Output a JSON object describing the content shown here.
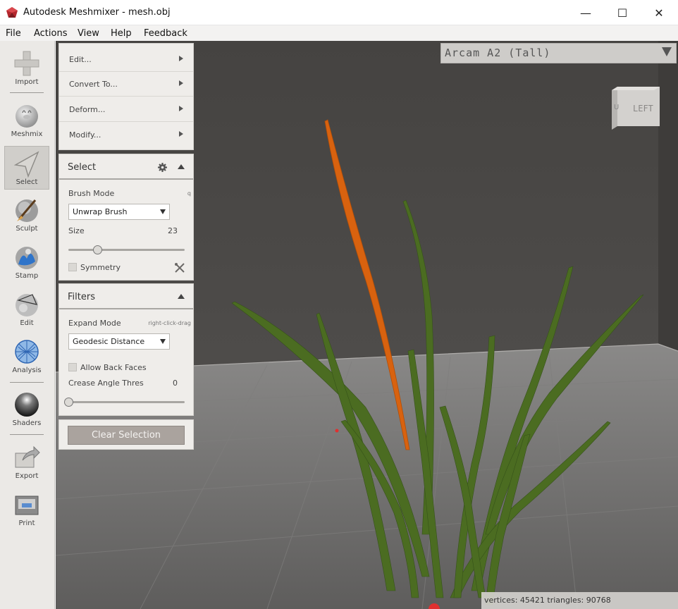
{
  "window": {
    "title": "Autodesk Meshmixer - mesh.obj",
    "minimize_glyph": "—",
    "maximize_glyph": "☐",
    "close_glyph": "✕"
  },
  "menu": [
    "File",
    "Actions",
    "View",
    "Help",
    "Feedback"
  ],
  "tools": [
    {
      "label": "Import",
      "icon": "plus-icon"
    },
    {
      "label": "Meshmix",
      "icon": "bunny-icon"
    },
    {
      "label": "Select",
      "icon": "cursor-arrow-icon",
      "active": true
    },
    {
      "label": "Sculpt",
      "icon": "brush-icon"
    },
    {
      "label": "Stamp",
      "icon": "stamp-icon"
    },
    {
      "label": "Edit",
      "icon": "edit-sphere-icon"
    },
    {
      "label": "Analysis",
      "icon": "analysis-sphere-icon"
    },
    {
      "label": "Shaders",
      "icon": "shader-sphere-icon"
    },
    {
      "label": "Export",
      "icon": "export-icon"
    },
    {
      "label": "Print",
      "icon": "printer-icon"
    }
  ],
  "operations": [
    "Edit...",
    "Convert To...",
    "Deform...",
    "Modify..."
  ],
  "select_panel": {
    "title": "Select",
    "brush_mode_label": "Brush Mode",
    "brush_mode_hint": "q",
    "brush_mode_value": "Unwrap Brush",
    "size_label": "Size",
    "size_value": "23",
    "size_fraction": 0.25,
    "symmetry_label": "Symmetry",
    "symmetry_checked": false
  },
  "filters_panel": {
    "title": "Filters",
    "expand_mode_label": "Expand Mode",
    "expand_mode_hint": "right-click-drag",
    "expand_mode_value": "Geodesic Distance",
    "allow_back_faces_label": "Allow Back Faces",
    "allow_back_faces_checked": false,
    "crease_label": "Crease Angle Thres",
    "crease_value": "0",
    "crease_fraction": 0.0
  },
  "clear_selection_label": "Clear Selection",
  "printer": "Arcam A2 (Tall)",
  "view_cube_face": "LEFT",
  "stats": "vertices: 45421 triangles: 90768",
  "colors": {
    "background_wall": "#4a4846",
    "floor": "#6e6d6c",
    "leaf_green": "#4d6d22",
    "selected_leaf": "#d8620f",
    "clear_button": "#aaa39e"
  }
}
